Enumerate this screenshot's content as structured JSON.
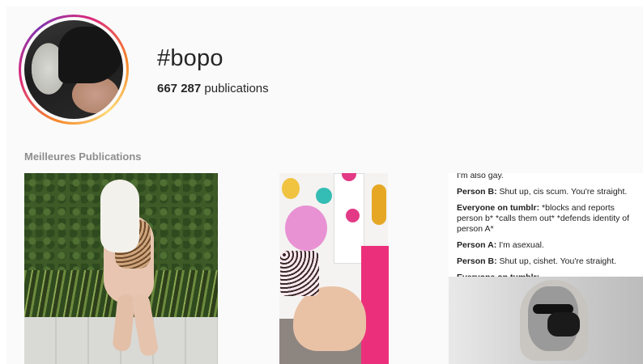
{
  "header": {
    "hashtag": "#bopo",
    "publication_count": "667 287",
    "publication_label": "publications"
  },
  "sections": {
    "top_posts_label": "Meilleures Publications"
  },
  "posts": [
    {
      "kind": "photo"
    },
    {
      "kind": "photo"
    },
    {
      "kind": "text-screenshot",
      "lines": [
        {
          "speaker": "",
          "text": "I'm also gay."
        },
        {
          "speaker": "Person B:",
          "text": "Shut up, cis scum. You're straight."
        },
        {
          "speaker": "Everyone on tumblr:",
          "text": "*blocks and reports person b* *calls them out* *defends identity of person A*"
        },
        {
          "speaker": "Person A:",
          "text": "I'm asexual."
        },
        {
          "speaker": "Person B:",
          "text": "Shut up, cishet. You're straight."
        },
        {
          "speaker": "Everyone on tumblr:",
          "text": ""
        }
      ]
    }
  ],
  "colors": {
    "ring_start": "#f58529",
    "ring_mid": "#dd2a7b",
    "ring_end": "#8134af",
    "muted_label": "#8e8e8e"
  }
}
